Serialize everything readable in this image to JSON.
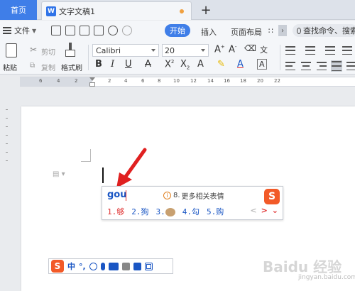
{
  "tabs": {
    "home": "首页",
    "doc_title": "文字文稿1",
    "doc_icon": "W",
    "add": "+"
  },
  "menu": {
    "file": "文件",
    "start": "开始",
    "insert": "插入",
    "layout": "页面布局",
    "search": "查找命令、搜索"
  },
  "ribbon": {
    "paste": "粘贴",
    "cut": "剪切",
    "copy": "复制",
    "format_painter": "格式刷",
    "font": "Calibri",
    "size": "20"
  },
  "ruler": {
    "numbers": [
      "6",
      "4",
      "2",
      "2",
      "4",
      "6",
      "8",
      "10",
      "12",
      "14",
      "16",
      "18",
      "20",
      "22"
    ]
  },
  "ime": {
    "pinyin": "gou",
    "info_number": "8.",
    "info_text": "更多相关表情",
    "logo": "S",
    "candidates": [
      "1.够",
      "2.狗",
      "3.",
      "4.勾",
      "5.购"
    ],
    "nav_prev": "<",
    "nav_next": ">"
  },
  "ime_bar": {
    "logo": "S",
    "lang": "中",
    "punct": "°,"
  },
  "watermark": {
    "text": "Baidu 经验",
    "sub": "jingyan.baidu.com"
  },
  "colors": {
    "accent": "#3f7ee8",
    "ime_red": "#e03030",
    "ime_blue": "#1a56c4",
    "sogou_orange": "#f25a28"
  }
}
